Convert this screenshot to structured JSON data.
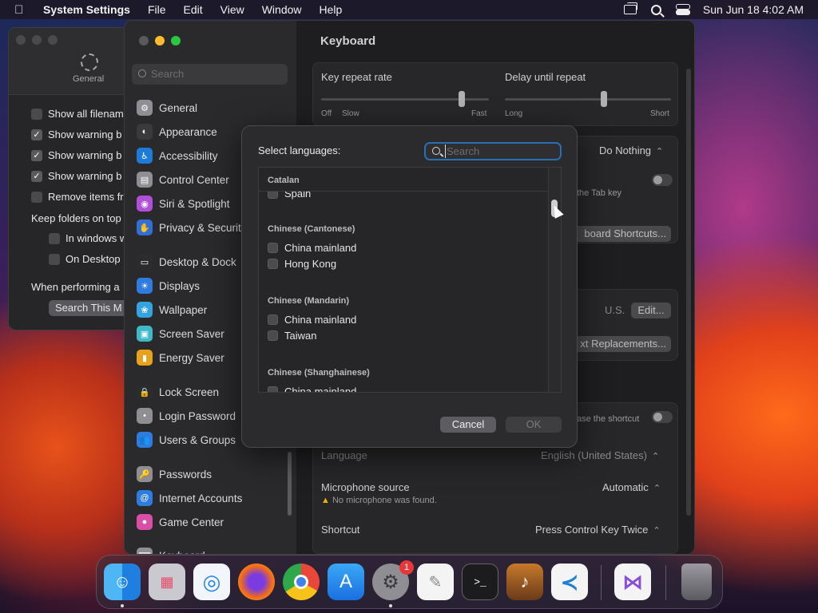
{
  "menubar": {
    "app_name": "System Settings",
    "items": [
      "File",
      "Edit",
      "View",
      "Window",
      "Help"
    ],
    "clock": "Sun Jun 18  4:02 AM"
  },
  "finder_window": {
    "tab_label": "General",
    "options": [
      {
        "label": "Show all filenam",
        "checked": false
      },
      {
        "label": "Show warning b",
        "checked": true
      },
      {
        "label": "Show warning b",
        "checked": true
      },
      {
        "label": "Show warning b",
        "checked": true
      },
      {
        "label": "Remove items fr",
        "checked": false
      }
    ],
    "keep_folders": "Keep folders on top",
    "sub_options": [
      {
        "label": "In windows w",
        "checked": false
      },
      {
        "label": "On Desktop",
        "checked": false
      }
    ],
    "when_performing": "When performing a",
    "search_button": "Search This M"
  },
  "settings": {
    "search_placeholder": "Search",
    "sidebar": [
      {
        "label": "General",
        "icon": "gear-icon",
        "color": "#8e8e93"
      },
      {
        "label": "Appearance",
        "icon": "appearance-icon",
        "color": "#3a3a3c"
      },
      {
        "label": "Accessibility",
        "icon": "accessibility-icon",
        "color": "#1e7bd8"
      },
      {
        "label": "Control Center",
        "icon": "control-center-icon",
        "color": "#8e8e93"
      },
      {
        "label": "Siri & Spotlight",
        "icon": "siri-icon",
        "color": "#b04fd8"
      },
      {
        "label": "Privacy & Securit",
        "icon": "hand-icon",
        "color": "#2f6fd6"
      },
      {
        "label": "Desktop & Dock",
        "icon": "dock-icon",
        "color": "#2c2c2e"
      },
      {
        "label": "Displays",
        "icon": "sun-icon",
        "color": "#2f7ce0"
      },
      {
        "label": "Wallpaper",
        "icon": "wallpaper-icon",
        "color": "#35a3e0"
      },
      {
        "label": "Screen Saver",
        "icon": "screensaver-icon",
        "color": "#3fb8c8"
      },
      {
        "label": "Energy Saver",
        "icon": "battery-icon",
        "color": "#e8a21a"
      },
      {
        "label": "Lock Screen",
        "icon": "lock-icon",
        "color": "#2c2c2e"
      },
      {
        "label": "Login Password",
        "icon": "password-icon",
        "color": "#8e8e93"
      },
      {
        "label": "Users & Groups",
        "icon": "users-icon",
        "color": "#2f7ce0"
      },
      {
        "label": "Passwords",
        "icon": "key-icon",
        "color": "#8e8e93"
      },
      {
        "label": "Internet Accounts",
        "icon": "at-icon",
        "color": "#2f7ce0"
      },
      {
        "label": "Game Center",
        "icon": "gamecenter-icon",
        "color": "#d84fa8"
      },
      {
        "label": "Keyboard",
        "icon": "keyboard-icon",
        "color": "#8e8e93"
      }
    ],
    "content": {
      "title": "Keyboard",
      "key_repeat_rate": "Key repeat rate",
      "delay_until_repeat": "Delay until repeat",
      "repeat_labels": {
        "off": "Off",
        "slow": "Slow",
        "fast": "Fast"
      },
      "delay_labels": {
        "long": "Long",
        "short": "Short"
      },
      "do_nothing": "Do Nothing",
      "tab_key_text": "the Tab key",
      "keyboard_shortcuts": "board Shortcuts...",
      "input_source": "U.S.",
      "edit": "Edit...",
      "text_replacements": "xt Replacements...",
      "shortcut_toggle_text": "ase the shortcut",
      "language_label": "Language",
      "language_value": "English (United States)",
      "microphone_label": "Microphone source",
      "microphone_value": "Automatic",
      "microphone_warning": "No microphone was found.",
      "shortcut_label": "Shortcut",
      "shortcut_value": "Press Control Key Twice"
    }
  },
  "sheet": {
    "title": "Select languages:",
    "search_placeholder": "Search",
    "sticky_header": "Catalan",
    "partial_item": "Spain",
    "groups": [
      {
        "header": "Chinese (Cantonese)",
        "items": [
          "China mainland",
          "Hong Kong"
        ]
      },
      {
        "header": "Chinese (Mandarin)",
        "items": [
          "China mainland",
          "Taiwan"
        ]
      },
      {
        "header": "Chinese (Shanghainese)",
        "items": [
          "China mainland"
        ]
      }
    ],
    "cancel": "Cancel",
    "ok": "OK"
  },
  "dock": {
    "apps": [
      {
        "name": "Finder",
        "icon": "finder-icon",
        "running": true
      },
      {
        "name": "Launchpad",
        "icon": "launchpad-icon",
        "running": false
      },
      {
        "name": "Safari",
        "icon": "safari-icon",
        "running": false
      },
      {
        "name": "Firefox",
        "icon": "firefox-icon",
        "running": false
      },
      {
        "name": "Chrome",
        "icon": "chrome-icon",
        "running": false
      },
      {
        "name": "App Store",
        "icon": "appstore-icon",
        "running": false
      },
      {
        "name": "System Settings",
        "icon": "system-settings-icon",
        "running": true,
        "badge": "1"
      },
      {
        "name": "TextEdit",
        "icon": "textedit-icon",
        "running": false
      },
      {
        "name": "Terminal",
        "icon": "terminal-icon",
        "running": false
      },
      {
        "name": "Instruments",
        "icon": "instruments-icon",
        "running": false
      },
      {
        "name": "VS Code",
        "icon": "vscode-icon",
        "running": false
      },
      {
        "name": "Visual Studio",
        "icon": "visual-studio-icon",
        "running": false
      },
      {
        "name": "Trash",
        "icon": "trash-icon",
        "running": false
      }
    ],
    "terminal_prompt": ">_"
  }
}
